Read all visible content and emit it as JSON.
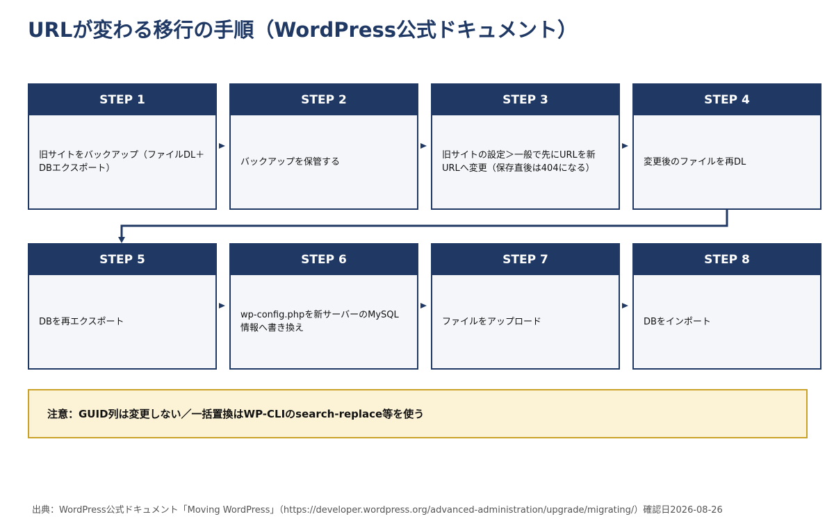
{
  "title": "URLが変わる移行の手順（WordPress公式ドキュメント）",
  "steps": [
    {
      "label": "STEP 1",
      "text": "旧サイトをバックアップ（ファイルDL＋DBエクスポート）"
    },
    {
      "label": "STEP 2",
      "text": "バックアップを保管する"
    },
    {
      "label": "STEP 3",
      "text": "旧サイトの設定＞一般で先にURLを新URLへ変更（保存直後は404になる）"
    },
    {
      "label": "STEP 4",
      "text": "変更後のファイルを再DL"
    },
    {
      "label": "STEP 5",
      "text": "DBを再エクスポート"
    },
    {
      "label": "STEP 6",
      "text": "wp-config.phpを新サーバーのMySQL情報へ書き換え"
    },
    {
      "label": "STEP 7",
      "text": "ファイルをアップロード"
    },
    {
      "label": "STEP 8",
      "text": "DBをインポート"
    }
  ],
  "note": "注意：GUID列は変更しない／一括置換はWP-CLIのsearch-replace等を使う",
  "source": "出典：WordPress公式ドキュメント「Moving WordPress」（https://developer.wordpress.org/advanced-administration/upgrade/migrating/）確認日2026-08-26",
  "colors": {
    "header": "#1f3864",
    "box_bg": "#f4f6fa",
    "note_border": "#c9a227",
    "note_bg": "#fcf3d6"
  }
}
